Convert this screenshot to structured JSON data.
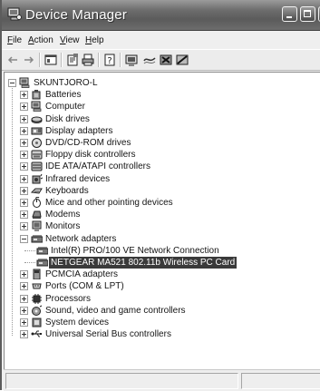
{
  "window": {
    "title": "Device Manager"
  },
  "menu": [
    {
      "label": "File",
      "mnemonic": "F",
      "rest": "ile"
    },
    {
      "label": "Action",
      "mnemonic": "A",
      "rest": "ction"
    },
    {
      "label": "View",
      "mnemonic": "V",
      "rest": "iew"
    },
    {
      "label": "Help",
      "mnemonic": "H",
      "rest": "elp"
    }
  ],
  "toolbar": {
    "icons": [
      "back-arrow-icon",
      "forward-arrow-icon",
      "show-hide-console-tree-icon",
      "properties-icon",
      "print-icon",
      "help-icon",
      "scan-hardware-icon",
      "update-driver-icon",
      "uninstall-icon",
      "disable-icon"
    ]
  },
  "tree": {
    "root": {
      "label": "SKUNTJORO-L",
      "icon": "computer-icon",
      "expanded": true
    },
    "categories": [
      {
        "label": "Batteries",
        "icon": "battery-icon",
        "expanded": false
      },
      {
        "label": "Computer",
        "icon": "computer-icon",
        "expanded": false
      },
      {
        "label": "Disk drives",
        "icon": "disk-drive-icon",
        "expanded": false
      },
      {
        "label": "Display adapters",
        "icon": "display-adapter-icon",
        "expanded": false
      },
      {
        "label": "DVD/CD-ROM drives",
        "icon": "dvd-drive-icon",
        "expanded": false
      },
      {
        "label": "Floppy disk controllers",
        "icon": "floppy-controller-icon",
        "expanded": false
      },
      {
        "label": "IDE ATA/ATAPI controllers",
        "icon": "ide-controller-icon",
        "expanded": false
      },
      {
        "label": "Infrared devices",
        "icon": "infrared-icon",
        "expanded": false
      },
      {
        "label": "Keyboards",
        "icon": "keyboard-icon",
        "expanded": false
      },
      {
        "label": "Mice and other pointing devices",
        "icon": "mouse-icon",
        "expanded": false
      },
      {
        "label": "Modems",
        "icon": "modem-icon",
        "expanded": false
      },
      {
        "label": "Monitors",
        "icon": "monitor-icon",
        "expanded": false
      },
      {
        "label": "Network adapters",
        "icon": "network-adapter-icon",
        "expanded": true,
        "children": [
          {
            "label": "Intel(R) PRO/100 VE Network Connection",
            "icon": "network-card-icon",
            "selected": false
          },
          {
            "label": "NETGEAR MA521 802.11b Wireless PC Card",
            "icon": "network-card-icon",
            "selected": true
          }
        ]
      },
      {
        "label": "PCMCIA adapters",
        "icon": "pcmcia-icon",
        "expanded": false
      },
      {
        "label": "Ports (COM & LPT)",
        "icon": "port-icon",
        "expanded": false
      },
      {
        "label": "Processors",
        "icon": "processor-icon",
        "expanded": false
      },
      {
        "label": "Sound, video and game controllers",
        "icon": "sound-icon",
        "expanded": false
      },
      {
        "label": "System devices",
        "icon": "system-devices-icon",
        "expanded": false
      },
      {
        "label": "Universal Serial Bus controllers",
        "icon": "usb-icon",
        "expanded": false
      }
    ]
  },
  "colors": {
    "titlebar": "#5b5b5b",
    "selection": "#3a3a3a"
  }
}
